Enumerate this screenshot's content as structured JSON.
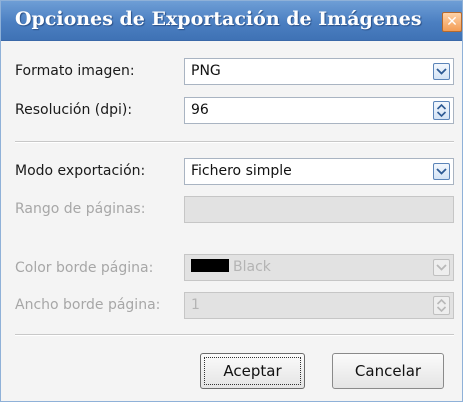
{
  "dialog": {
    "title": "Opciones de Exportación de Imágenes",
    "close_symbol": "✕"
  },
  "fields": {
    "formato": {
      "label": "Formato imagen:",
      "value": "PNG"
    },
    "resolucion": {
      "label": "Resolución (dpi):",
      "value": "96"
    },
    "modo": {
      "label": "Modo exportación:",
      "value": "Fichero simple"
    },
    "rango": {
      "label": "Rango de páginas:",
      "value": ""
    },
    "color_borde": {
      "label": "Color borde página:",
      "value": "Black",
      "swatch_color": "#000000"
    },
    "ancho_borde": {
      "label": "Ancho borde página:",
      "value": "1"
    }
  },
  "buttons": {
    "accept_label": "Aceptar",
    "cancel_label": "Cancelar"
  },
  "icons": {
    "dropdown": "chevron-down-icon",
    "spinner": "spinner-arrows-icon",
    "close": "close-icon"
  },
  "colors": {
    "titlebar": "#4b7fc1",
    "close_button": "#f39c55",
    "disabled_text": "#a7a7a7"
  }
}
